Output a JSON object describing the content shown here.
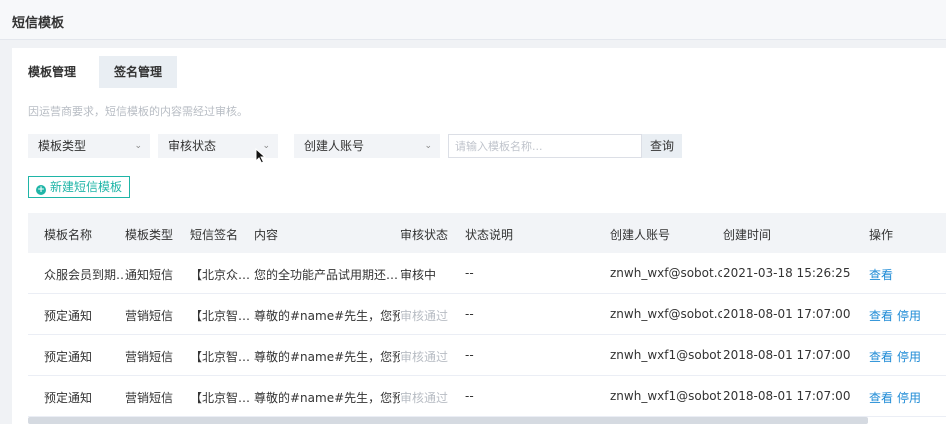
{
  "page": {
    "title": "短信模板"
  },
  "tabs": [
    {
      "label": "模板管理"
    },
    {
      "label": "签名管理"
    }
  ],
  "notice": "因运营商要求，短信模板的内容需经过审核。",
  "filters": {
    "template_type": "模板类型",
    "review_status": "审核状态",
    "creator_account": "创建人账号",
    "search_placeholder": "请输入模板名称...",
    "query_label": "查询"
  },
  "new_template_label": "新建短信模板",
  "table": {
    "headers": {
      "name": "模板名称",
      "type": "模板类型",
      "signature": "短信签名",
      "content": "内容",
      "status": "审核状态",
      "status_note": "状态说明",
      "creator": "创建人账号",
      "created_time": "创建时间",
      "actions": "操作"
    },
    "rows": [
      {
        "name": "众服会员到期…",
        "type": "通知短信",
        "signature": "【北京众…",
        "content": "您的全功能产品试用期还…",
        "status": "审核中",
        "status_note": "--",
        "creator": "znwh_wxf@sobot.c…",
        "created_time": "2021-03-18 15:26:25",
        "action_view": "查看",
        "action_disable": ""
      },
      {
        "name": "预定通知",
        "type": "营销短信",
        "signature": "【北京智…",
        "content": "尊敬的#name#先生，您预…",
        "status": "审核通过",
        "status_note": "--",
        "creator": "znwh_wxf@sobot.c…",
        "created_time": "2018-08-01 17:07:00",
        "action_view": "查看",
        "action_disable": "停用"
      },
      {
        "name": "预定通知",
        "type": "营销短信",
        "signature": "【北京智…",
        "content": "尊敬的#name#先生，您预…",
        "status": "审核通过",
        "status_note": "--",
        "creator": "znwh_wxf1@sobot.…",
        "created_time": "2018-08-01 17:07:00",
        "action_view": "查看",
        "action_disable": "停用"
      },
      {
        "name": "预定通知",
        "type": "营销短信",
        "signature": "【北京智…",
        "content": "尊敬的#name#先生，您预…",
        "status": "审核通过",
        "status_note": "--",
        "creator": "znwh_wxf1@sobot.…",
        "created_time": "2018-08-01 17:07:00",
        "action_view": "查看",
        "action_disable": "停用"
      }
    ]
  },
  "colors": {
    "accent": "#1fb5a7",
    "link": "#1e8bd6",
    "muted": "#b8bdc4"
  }
}
